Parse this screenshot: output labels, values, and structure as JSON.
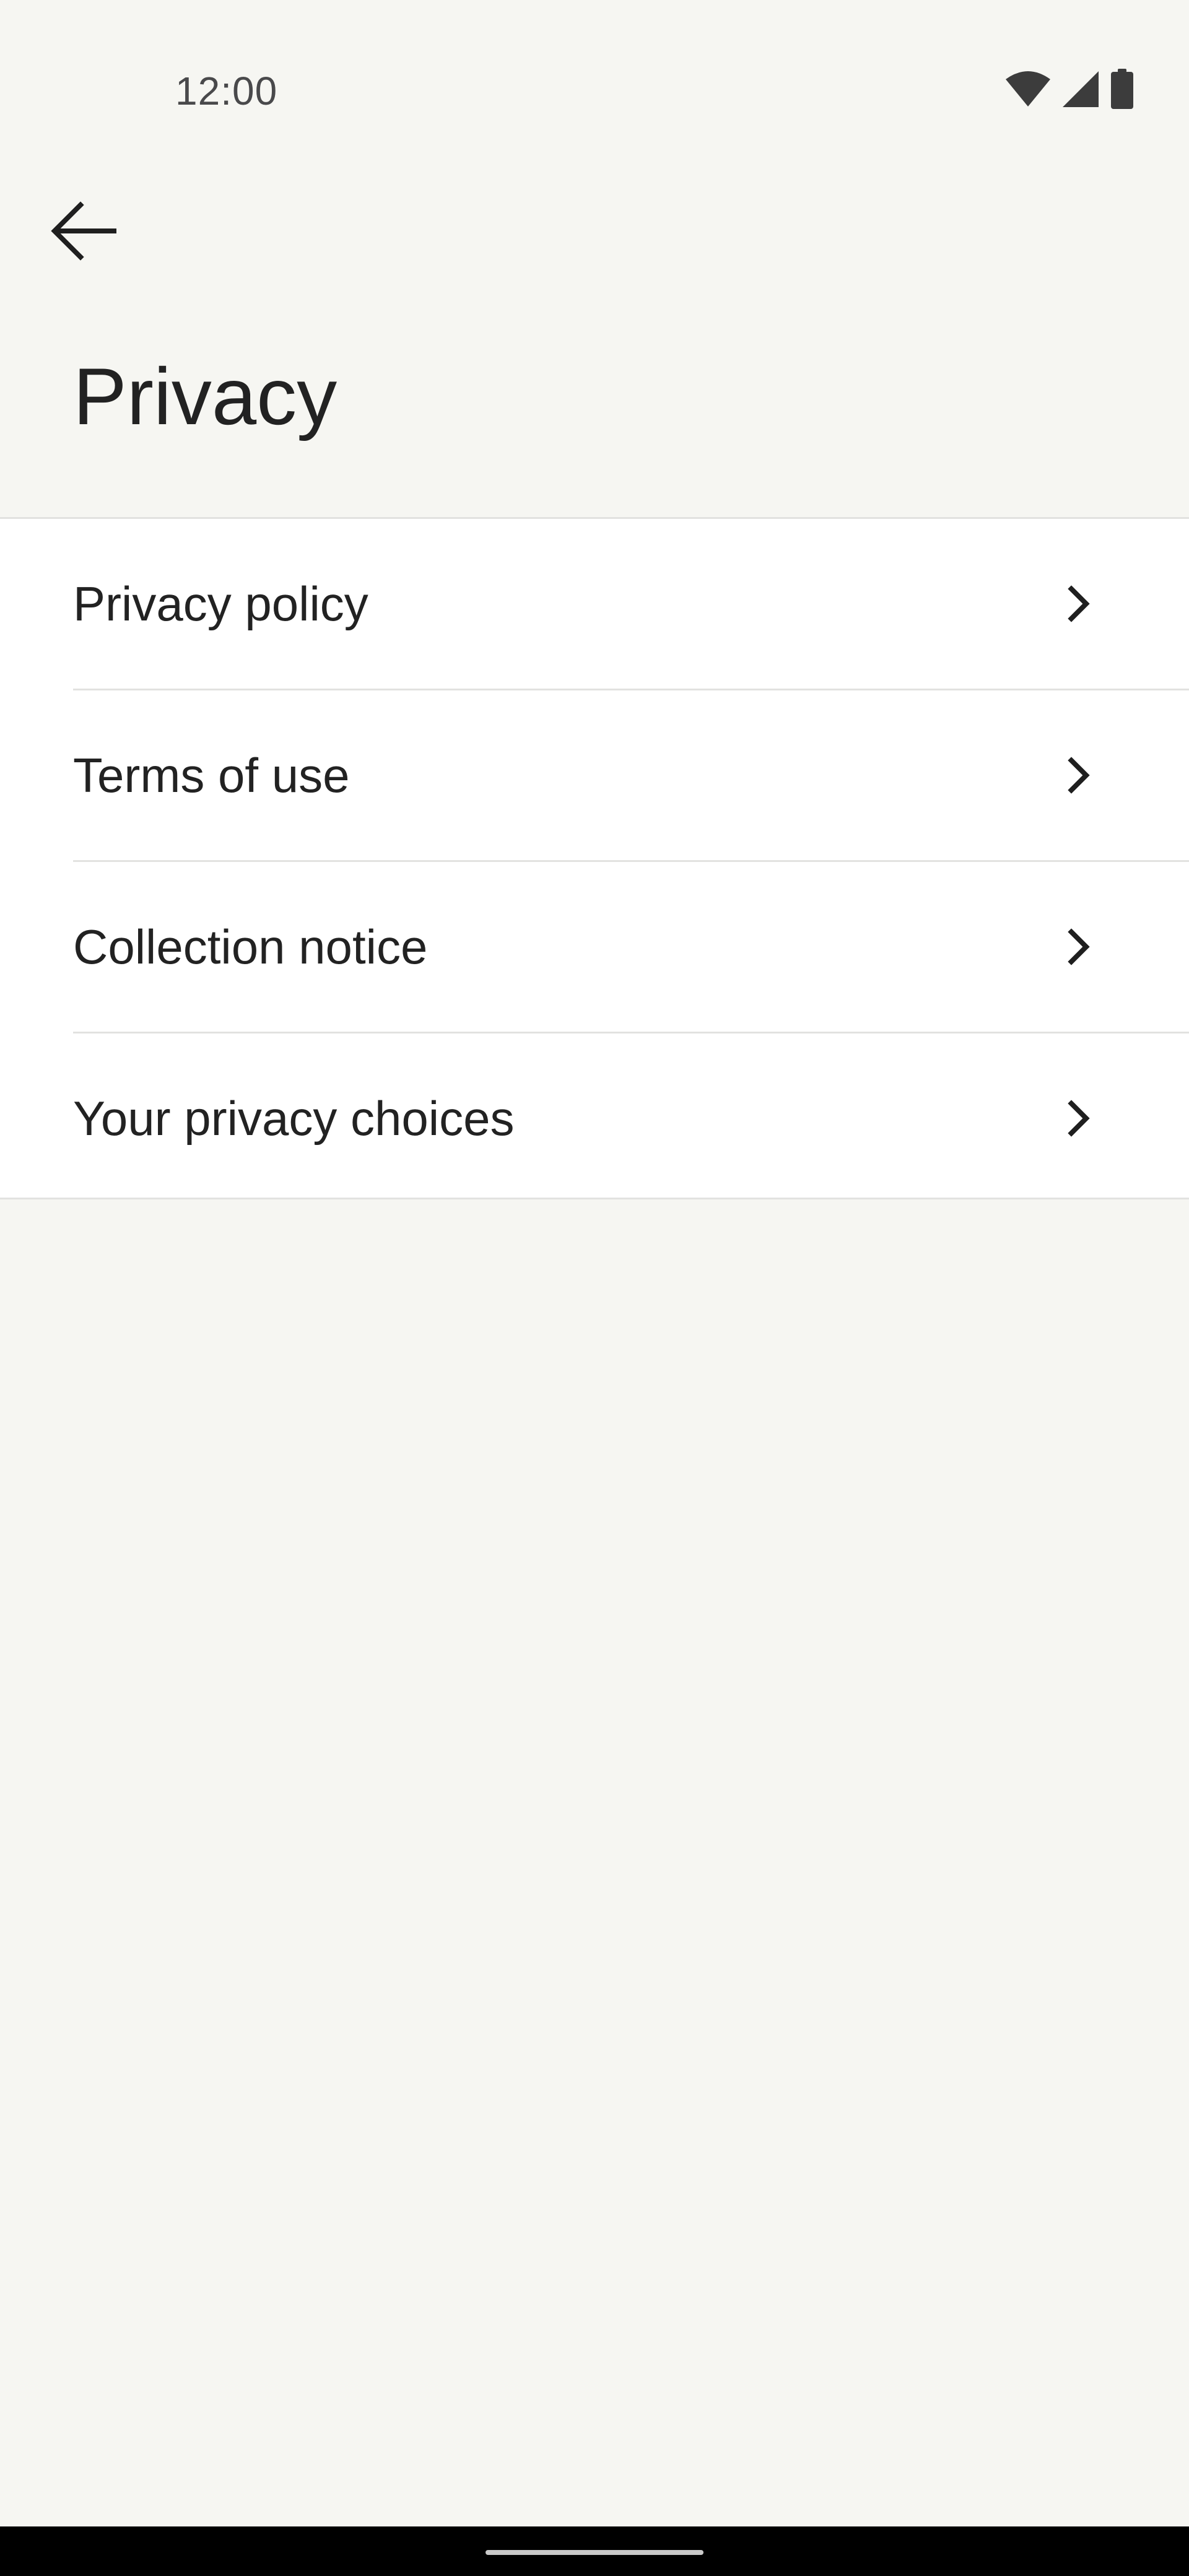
{
  "status_bar": {
    "time": "12:00",
    "icons": [
      "wifi-icon",
      "cellular-signal-icon",
      "battery-icon"
    ]
  },
  "header": {
    "back_icon": "arrow-left-icon",
    "title": "Privacy"
  },
  "settings_list": {
    "items": [
      {
        "label": "Privacy policy",
        "icon": "chevron-right-icon"
      },
      {
        "label": "Terms of use",
        "icon": "chevron-right-icon"
      },
      {
        "label": "Collection notice",
        "icon": "chevron-right-icon"
      },
      {
        "label": "Your privacy choices",
        "icon": "chevron-right-icon"
      }
    ]
  },
  "colors": {
    "background": "#f6f6f2",
    "list_background": "#ffffff",
    "divider": "#e2e2e0",
    "text": "#222222",
    "nav_bar": "#000000"
  }
}
